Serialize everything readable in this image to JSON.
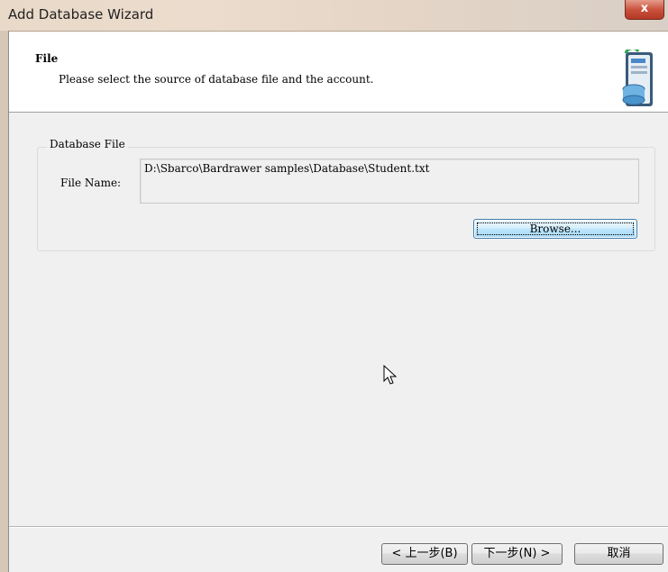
{
  "window": {
    "title": "Add Database Wizard",
    "close_label": "x"
  },
  "header": {
    "title": "File",
    "description": "Please select the source of database file and the account.",
    "icon": "database-file-icon"
  },
  "database_file": {
    "legend": "Database File",
    "file_name_label": "File Name:",
    "file_name_value": "D:\\Sbarco\\Bardrawer samples\\Database\\Student.txt",
    "browse_label": "Browse..."
  },
  "footer": {
    "back_label": "< 上一步(B)",
    "next_label": "下一步(N) >",
    "cancel_label": "取消"
  }
}
